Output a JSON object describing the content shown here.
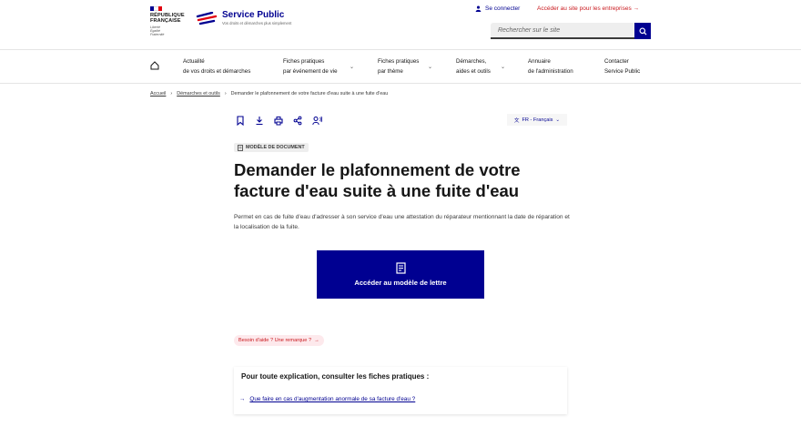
{
  "header": {
    "republique_lines": [
      "RÉPUBLIQUE",
      "FRANÇAISE"
    ],
    "devise_lines": [
      "Liberté",
      "Égalité",
      "Fraternité"
    ],
    "site_title": "Service Public",
    "tagline": "Vos droits et démarches plus simplement",
    "login_label": "Se connecter",
    "pro_link_label": "Accéder au site pour les entreprises",
    "search_placeholder": "Rechercher sur le site"
  },
  "nav": {
    "items": [
      {
        "line1": "Actualité",
        "line2": "de vos droits et démarches"
      },
      {
        "line1": "Fiches pratiques",
        "line2": "par événement de vie"
      },
      {
        "line1": "Fiches pratiques",
        "line2": "par thème"
      },
      {
        "line1": "Démarches,",
        "line2": "aides et outils"
      },
      {
        "line1": "Annuaire",
        "line2": "de l'administration"
      },
      {
        "line1": "Contacter",
        "line2": "Service Public"
      }
    ]
  },
  "breadcrumb": {
    "items": [
      "Accueil",
      "Démarches et outils"
    ],
    "current": "Demander le plafonnement de votre facture d'eau suite à une fuite d'eau"
  },
  "language": "FR - Français",
  "badge": "MODÈLE DE DOCUMENT",
  "page_title": "Demander le plafonnement de votre facture d'eau suite à une fuite d'eau",
  "intro": "Permet en cas de fuite d'eau d'adresser à son service d'eau une attestation du réparateur mentionnant la date de réparation et la localisation de la fuite.",
  "cta_label": "Accéder au modèle de lettre",
  "help_label": "Besoin d'aide ? Une remarque ?",
  "related": {
    "title": "Pour toute explication, consulter les fiches pratiques :",
    "link": "Que faire en cas d'augmentation anormale de sa facture d'eau ?"
  },
  "colors": {
    "brand_blue": "#000091",
    "brand_red": "#e1000f"
  }
}
